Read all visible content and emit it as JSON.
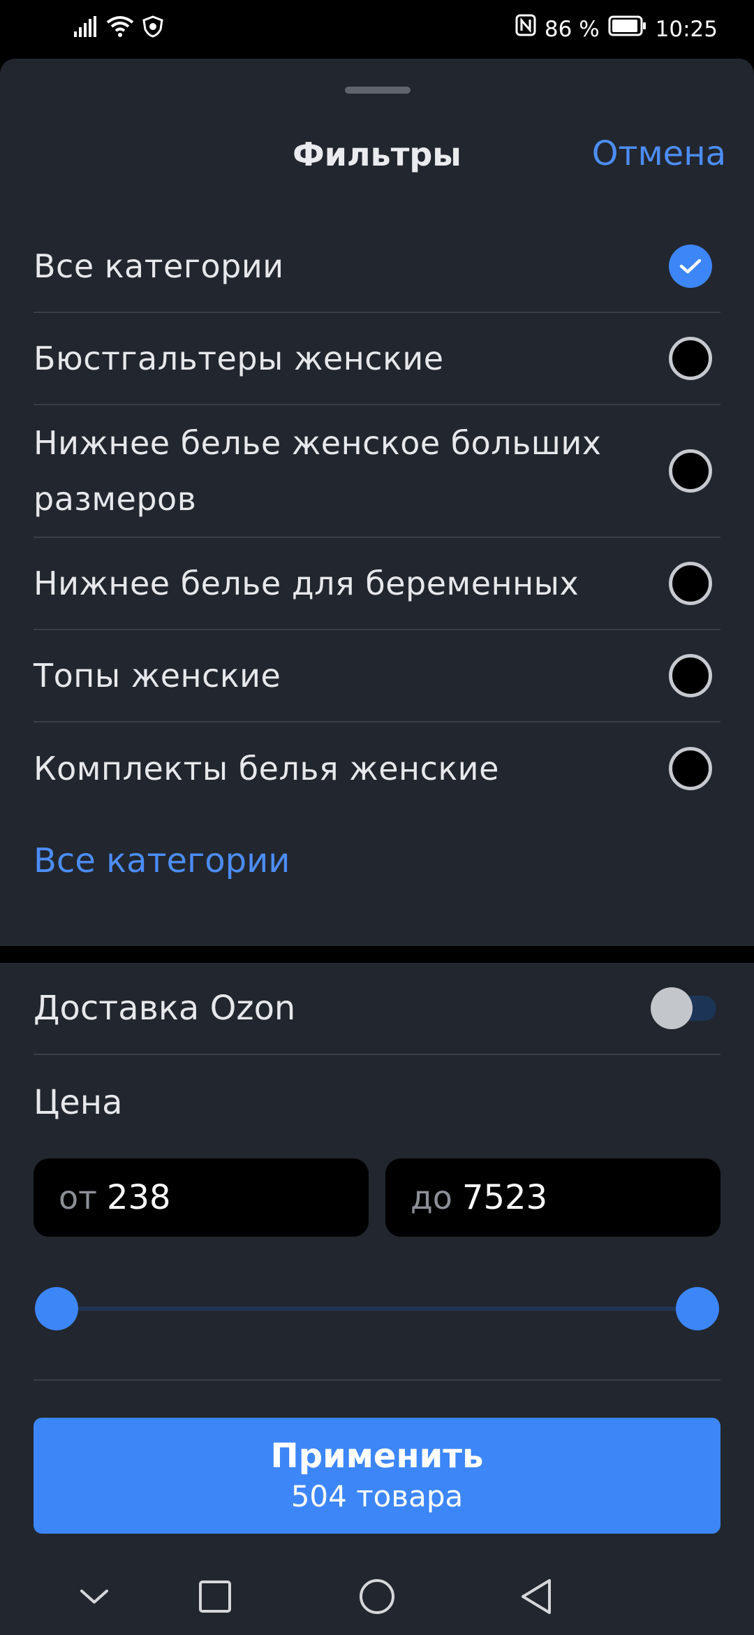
{
  "status_bar": {
    "battery_percent": "86 %",
    "time": "10:25",
    "icons": [
      "signal-icon",
      "wifi-icon",
      "shield-icon",
      "nfc-icon",
      "battery-icon"
    ]
  },
  "sheet": {
    "title": "Фильтры",
    "cancel_label": "Отмена"
  },
  "categories": {
    "items": [
      {
        "label": "Все категории",
        "checked": true
      },
      {
        "label": "Бюстгальтеры женские",
        "checked": false
      },
      {
        "label": "Нижнее белье женское больших размеров",
        "checked": false
      },
      {
        "label": "Нижнее белье для беременных",
        "checked": false
      },
      {
        "label": "Топы женские",
        "checked": false
      },
      {
        "label": "Комплекты белья женские",
        "checked": false
      }
    ],
    "all_link": "Все категории"
  },
  "delivery": {
    "label": "Доставка Ozon",
    "enabled": false
  },
  "price": {
    "label": "Цена",
    "from_prefix": "от",
    "from_value": "238",
    "to_prefix": "до",
    "to_value": "7523",
    "slider_min_fraction": 0,
    "slider_max_fraction": 1
  },
  "apply": {
    "title": "Применить",
    "subtitle": "504 товара"
  },
  "colors": {
    "accent": "#3d86f7",
    "background": "#22262e"
  },
  "navbar": {
    "icons": [
      "chevron-down-icon",
      "recent-apps-icon",
      "home-icon",
      "back-icon"
    ]
  }
}
